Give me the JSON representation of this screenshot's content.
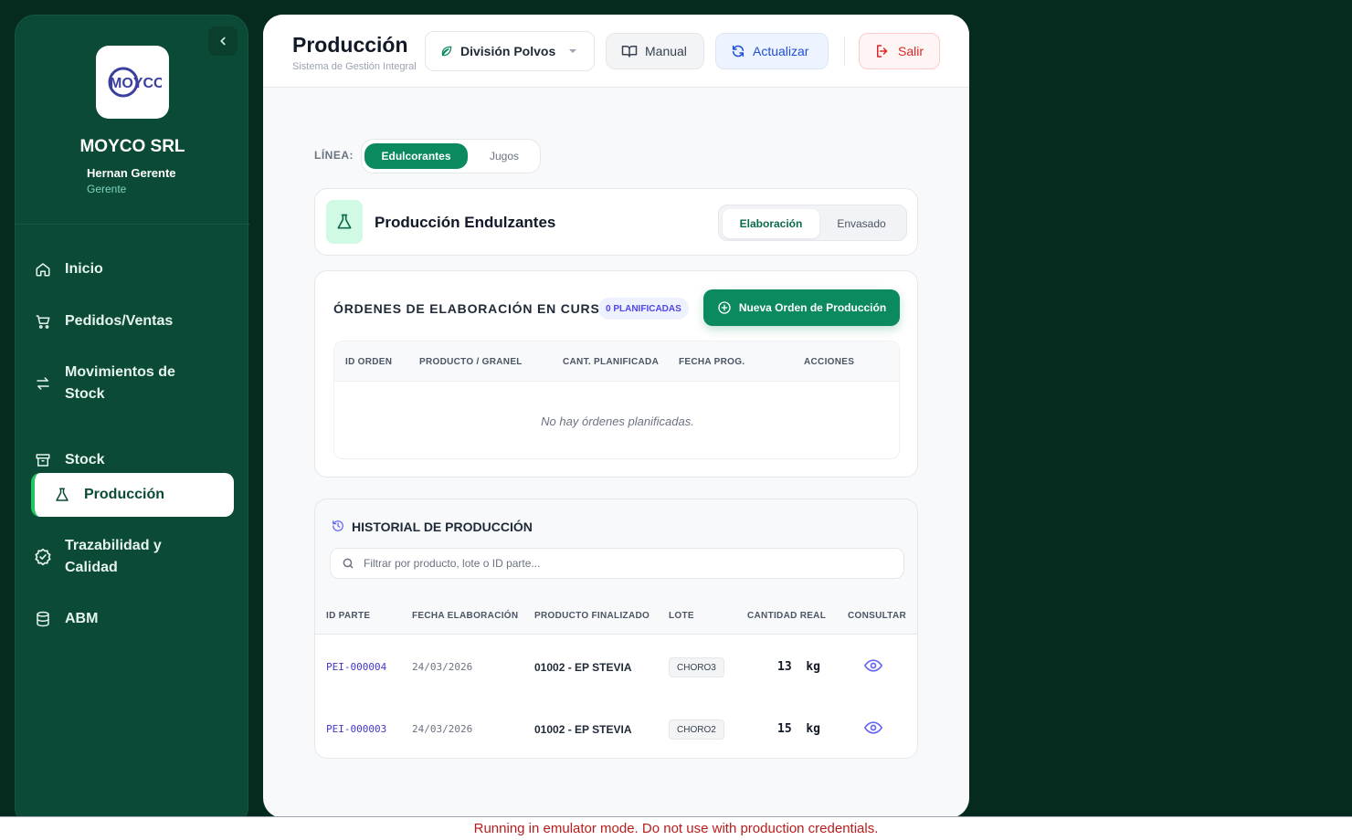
{
  "sidebar": {
    "logo_text": "MOYCO",
    "company": "MOYCO SRL",
    "user_name": "Hernan Gerente",
    "user_role": "Gerente",
    "items": [
      {
        "label": "Inicio",
        "icon": "home-icon"
      },
      {
        "label": "Pedidos/Ventas",
        "icon": "cart-icon"
      },
      {
        "label": "Movimientos de Stock",
        "icon": "swap-icon"
      },
      {
        "label": "Stock",
        "icon": "archive-icon"
      },
      {
        "label": "Producción",
        "icon": "flask-icon",
        "active": true
      },
      {
        "label": "Trazabilidad y Calidad",
        "icon": "badge-check-icon"
      },
      {
        "label": "ABM",
        "icon": "database-icon"
      }
    ]
  },
  "header": {
    "title": "Producción",
    "subtitle": "Sistema de Gestión Integral",
    "division": "División Polvos",
    "manual": "Manual",
    "refresh": "Actualizar",
    "exit": "Salir"
  },
  "line_selector": {
    "label": "LÍNEA:",
    "options": [
      "Edulcorantes",
      "Jugos"
    ],
    "selected": "Edulcorantes"
  },
  "production_card": {
    "title": "Producción Endulzantes",
    "stages": [
      "Elaboración",
      "Envasado"
    ],
    "selected_stage": "Elaboración"
  },
  "orders": {
    "title": "ÓRDENES DE ELABORACIÓN EN CURSO",
    "badge": "0 PLANIFICADAS",
    "new_button": "Nueva Orden de Producción",
    "columns": [
      "ID ORDEN",
      "PRODUCTO / GRANEL",
      "CANT. PLANIFICADA",
      "FECHA PROG.",
      "ACCIONES"
    ],
    "empty": "No hay órdenes planificadas."
  },
  "history": {
    "title": "HISTORIAL DE PRODUCCIÓN",
    "search_placeholder": "Filtrar por producto, lote o ID parte...",
    "columns": [
      "ID PARTE",
      "FECHA ELABORACIÓN",
      "PRODUCTO FINALIZADO",
      "LOTE",
      "CANTIDAD REAL",
      "CONSULTAR"
    ],
    "rows": [
      {
        "id": "PEI-000004",
        "date": "24/03/2026",
        "product": "01002 - EP STEVIA",
        "lot": "CHORO3",
        "qty": "13  kg"
      },
      {
        "id": "PEI-000003",
        "date": "24/03/2026",
        "product": "01002 - EP STEVIA",
        "lot": "CHORO2",
        "qty": "15  kg"
      }
    ]
  },
  "footer": {
    "emulator_notice": "Running in emulator mode. Do not use with production credentials."
  },
  "colors": {
    "brand_green": "#0b8a5f",
    "sidebar_bg": "#0b4a36",
    "page_bg": "#052a1e",
    "danger": "#dc2626",
    "accent_indigo": "#4f46e5"
  }
}
